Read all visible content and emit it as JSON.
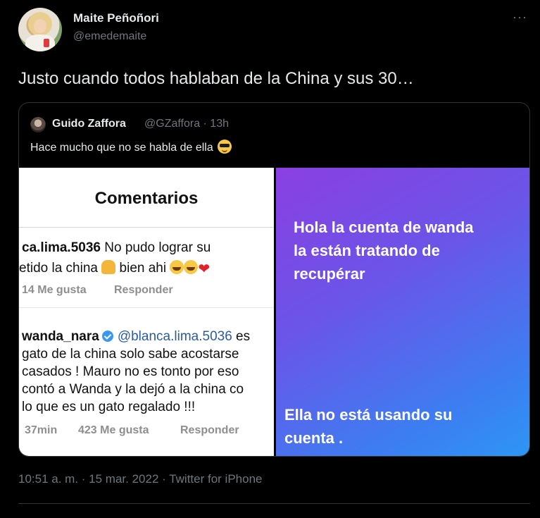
{
  "author": {
    "name": "Maite Peñoñori",
    "handle": "@emedemaite"
  },
  "more_label": "···",
  "tweet_text": "Justo cuando todos hablaban de la China y sus 30…",
  "quoted": {
    "name": "Guido Zaffora",
    "handle_time": "@GZaffora · 13h",
    "text": "Hace mucho que no se habla de ella",
    "emoji": "sunglasses-emoji"
  },
  "media_left": {
    "title": "Comentarios",
    "comment1": {
      "line1_user": "ca.lima.5036",
      "line1_text": " No pudo lograr su",
      "line2_text": "etido la china ",
      "line2_after": " bien ahi ",
      "likes": "14 Me gusta",
      "reply": "Responder"
    },
    "comment2": {
      "user": "wanda_nara",
      "mention": "@blanca.lima.5036",
      "mention_tail": " es",
      "lines": [
        "gato de la china solo sabe acostarse",
        "casados ! Mauro no es tonto por eso",
        "contó a Wanda y la dejó a la china  co",
        "lo que es un gato regalado !!!"
      ],
      "time": "37min",
      "likes": "423 Me gusta",
      "reply": "Responder"
    }
  },
  "media_right": {
    "top_lines": [
      "Hola la cuenta de wanda",
      "la están tratando de",
      "recupérar"
    ],
    "bottom_lines": [
      "Ella no está usando su",
      "cuenta ."
    ]
  },
  "timestamp": "10:51 a. m. · 15 mar. 2022 · Twitter for iPhone"
}
